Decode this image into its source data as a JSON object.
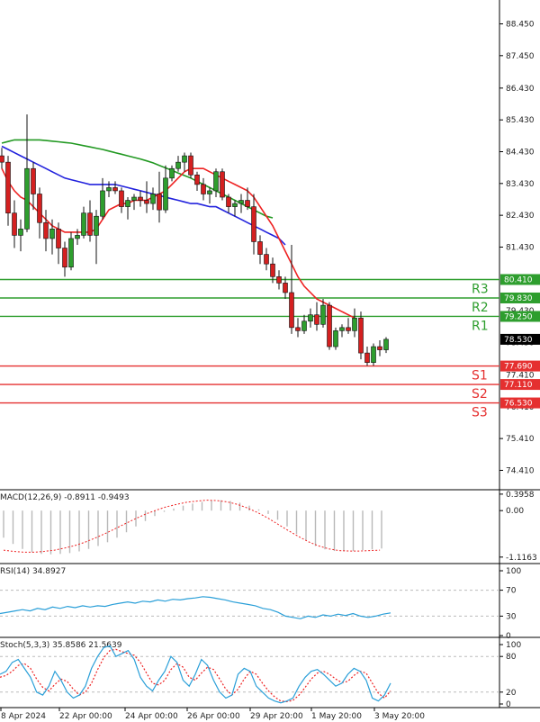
{
  "chart_data": [
    {
      "type": "candlestick",
      "ylim": [
        73.8,
        89.2
      ],
      "yticks": [
        "88.450",
        "87.450",
        "86.430",
        "85.430",
        "84.430",
        "83.430",
        "82.430",
        "81.430",
        "75.410",
        "74.410"
      ],
      "ytick_values": [
        88.45,
        87.45,
        86.43,
        85.43,
        84.43,
        83.43,
        82.43,
        81.43,
        75.41,
        74.41
      ],
      "ohlc": [
        [
          84.3,
          84.55,
          83.9,
          84.1
        ],
        [
          84.1,
          84.3,
          82.1,
          82.5
        ],
        [
          82.5,
          82.9,
          81.4,
          81.8
        ],
        [
          81.8,
          82.3,
          81.3,
          82.0
        ],
        [
          82.0,
          85.6,
          81.9,
          83.9
        ],
        [
          83.9,
          84.1,
          82.6,
          83.1
        ],
        [
          83.1,
          83.3,
          81.7,
          82.2
        ],
        [
          82.2,
          82.6,
          81.3,
          81.7
        ],
        [
          81.7,
          82.3,
          81.2,
          82.0
        ],
        [
          82.0,
          82.2,
          80.9,
          81.4
        ],
        [
          81.4,
          81.6,
          80.5,
          80.8
        ],
        [
          80.8,
          81.9,
          80.7,
          81.7
        ],
        [
          81.7,
          82.0,
          81.5,
          81.8
        ],
        [
          81.8,
          82.7,
          81.7,
          82.5
        ],
        [
          82.5,
          82.9,
          81.6,
          81.8
        ],
        [
          81.8,
          82.6,
          80.9,
          82.4
        ],
        [
          82.4,
          83.6,
          82.3,
          83.2
        ],
        [
          83.2,
          83.5,
          83.0,
          83.3
        ],
        [
          83.3,
          83.5,
          83.1,
          83.2
        ],
        [
          83.2,
          83.3,
          82.5,
          82.7
        ],
        [
          82.7,
          83.0,
          82.3,
          82.9
        ],
        [
          82.9,
          83.1,
          82.6,
          83.0
        ],
        [
          83.0,
          83.2,
          82.7,
          82.9
        ],
        [
          82.9,
          83.5,
          82.5,
          82.8
        ],
        [
          82.8,
          83.3,
          82.6,
          83.1
        ],
        [
          83.1,
          83.8,
          82.2,
          82.6
        ],
        [
          82.6,
          84.0,
          82.5,
          83.6
        ],
        [
          83.6,
          84.0,
          83.5,
          83.9
        ],
        [
          83.9,
          84.3,
          83.8,
          84.1
        ],
        [
          84.1,
          84.4,
          83.8,
          84.3
        ],
        [
          84.3,
          84.4,
          83.6,
          83.7
        ],
        [
          83.7,
          83.8,
          83.2,
          83.4
        ],
        [
          83.4,
          83.6,
          82.9,
          83.1
        ],
        [
          83.1,
          83.3,
          82.8,
          83.2
        ],
        [
          83.2,
          83.9,
          83.0,
          83.8
        ],
        [
          83.8,
          83.9,
          82.9,
          83.0
        ],
        [
          83.0,
          83.1,
          82.5,
          82.7
        ],
        [
          82.7,
          82.9,
          82.4,
          82.8
        ],
        [
          82.8,
          83.1,
          82.5,
          82.9
        ],
        [
          82.9,
          83.3,
          82.6,
          82.7
        ],
        [
          82.7,
          83.1,
          81.2,
          81.6
        ],
        [
          81.6,
          81.8,
          80.9,
          81.2
        ],
        [
          81.2,
          81.4,
          80.7,
          80.9
        ],
        [
          80.9,
          81.1,
          80.3,
          80.5
        ],
        [
          80.5,
          80.7,
          80.1,
          80.3
        ],
        [
          80.3,
          80.5,
          79.8,
          80.0
        ],
        [
          80.0,
          81.5,
          78.7,
          78.9
        ],
        [
          78.9,
          79.2,
          78.6,
          78.8
        ],
        [
          78.8,
          79.3,
          78.7,
          79.1
        ],
        [
          79.1,
          79.5,
          78.9,
          79.3
        ],
        [
          79.3,
          79.7,
          78.8,
          79.0
        ],
        [
          79.0,
          79.8,
          78.9,
          79.6
        ],
        [
          79.6,
          79.7,
          78.2,
          78.3
        ],
        [
          78.3,
          78.9,
          78.2,
          78.8
        ],
        [
          78.8,
          79.0,
          78.6,
          78.9
        ],
        [
          78.9,
          79.2,
          78.7,
          78.8
        ],
        [
          78.8,
          79.5,
          78.6,
          79.2
        ],
        [
          79.2,
          79.4,
          77.9,
          78.1
        ],
        [
          78.1,
          78.3,
          77.7,
          77.8
        ],
        [
          77.8,
          78.4,
          77.7,
          78.3
        ],
        [
          78.3,
          78.5,
          78.0,
          78.2
        ],
        [
          78.2,
          78.6,
          78.1,
          78.53
        ]
      ],
      "ma_fast": [
        83.9,
        83.5,
        83.2,
        83.0,
        82.9,
        82.7,
        82.5,
        82.3,
        82.1,
        82.0,
        81.9,
        81.9,
        81.9,
        81.9,
        81.9,
        82.0,
        82.3,
        82.6,
        82.7,
        82.8,
        82.8,
        82.9,
        82.9,
        82.9,
        83.0,
        83.1,
        83.2,
        83.4,
        83.6,
        83.8,
        83.9,
        83.9,
        83.9,
        83.8,
        83.7,
        83.6,
        83.5,
        83.4,
        83.3,
        83.2,
        83.0,
        82.7,
        82.4,
        82.1,
        81.7,
        81.3,
        80.9,
        80.5,
        80.2,
        80.0,
        79.8,
        79.7,
        79.6,
        79.5,
        79.4,
        79.3,
        79.2
      ],
      "ma_mid": [
        84.6,
        84.5,
        84.4,
        84.3,
        84.2,
        84.1,
        84.0,
        83.9,
        83.8,
        83.7,
        83.6,
        83.55,
        83.5,
        83.45,
        83.4,
        83.4,
        83.4,
        83.4,
        83.4,
        83.35,
        83.3,
        83.25,
        83.2,
        83.15,
        83.1,
        83.05,
        83.0,
        82.95,
        82.9,
        82.85,
        82.8,
        82.8,
        82.75,
        82.7,
        82.7,
        82.6,
        82.5,
        82.4,
        82.3,
        82.2,
        82.1,
        82.0,
        81.9,
        81.8,
        81.7,
        81.5
      ],
      "ma_slow": [
        84.7,
        84.75,
        84.8,
        84.8,
        84.8,
        84.8,
        84.8,
        84.78,
        84.76,
        84.74,
        84.72,
        84.7,
        84.66,
        84.62,
        84.58,
        84.54,
        84.5,
        84.45,
        84.4,
        84.35,
        84.3,
        84.25,
        84.2,
        84.14,
        84.08,
        84.0,
        83.92,
        83.84,
        83.76,
        83.68,
        83.6,
        83.5,
        83.4,
        83.3,
        83.2,
        83.1,
        83.0,
        82.9,
        82.8,
        82.7,
        82.6,
        82.5,
        82.4,
        82.35
      ],
      "levels": [
        {
          "name": "R3",
          "value": 80.41,
          "label": "80.410",
          "color": "#2e9e2e"
        },
        {
          "name": "R2",
          "value": 79.83,
          "label": "79.830",
          "color": "#2e9e2e"
        },
        {
          "name": "R1",
          "value": 79.25,
          "label": "79.250",
          "color": "#2e9e2e"
        },
        {
          "name": "S1",
          "value": 77.69,
          "label": "77.690",
          "color": "#e53030"
        },
        {
          "name": "S2",
          "value": 77.11,
          "label": "77.110",
          "color": "#e53030"
        },
        {
          "name": "S3",
          "value": 76.53,
          "label": "76.530",
          "color": "#e53030"
        }
      ],
      "last_price": {
        "value": 78.53,
        "label": "78.530"
      },
      "partial_ticks": [
        {
          "text": "79.430",
          "value": 79.43
        },
        {
          "text": "77.410",
          "value": 77.41
        },
        {
          "text": "76.410",
          "value": 76.41
        },
        {
          "text": "78.430",
          "value": 78.43
        }
      ],
      "colors": {
        "bull": "#2e9e2e",
        "bear": "#d42020",
        "ma_fast": "#ee2222",
        "ma_mid": "#2222dd",
        "ma_slow": "#229922"
      }
    },
    {
      "type": "bar",
      "name": "MACD",
      "header": "MACD(12,26,9) -0.8911 -0.9493",
      "ylim": [
        -1.25,
        0.48
      ],
      "yticks": [
        "0.3958",
        "0.00",
        "-1.1163"
      ],
      "ytick_values": [
        0.3958,
        0.0,
        -1.1163
      ],
      "histogram": [
        -0.65,
        -0.8,
        -0.92,
        -1.0,
        -1.04,
        -1.05,
        -1.04,
        -1.02,
        -0.98,
        -0.92,
        -0.85,
        -0.76,
        -0.65,
        -0.52,
        -0.38,
        -0.25,
        -0.13,
        -0.03,
        0.05,
        0.12,
        0.17,
        0.21,
        0.24,
        0.25,
        0.23,
        0.19,
        0.12,
        0.03,
        -0.08,
        -0.22,
        -0.38,
        -0.56,
        -0.72,
        -0.85,
        -0.93,
        -0.97,
        -0.98,
        -0.97,
        -0.95,
        -0.93,
        -0.91
      ],
      "signal": [
        -0.95,
        -0.98,
        -1.0,
        -1.0,
        -0.98,
        -0.95,
        -0.9,
        -0.84,
        -0.76,
        -0.66,
        -0.55,
        -0.43,
        -0.31,
        -0.19,
        -0.08,
        0.01,
        0.09,
        0.15,
        0.2,
        0.23,
        0.25,
        0.24,
        0.21,
        0.15,
        0.06,
        -0.05,
        -0.18,
        -0.33,
        -0.48,
        -0.62,
        -0.75,
        -0.85,
        -0.92,
        -0.96,
        -0.97,
        -0.97,
        -0.96,
        -0.95
      ],
      "colors": {
        "bars": "#b8b8b8",
        "signal": "#ee2222"
      }
    },
    {
      "type": "line",
      "name": "RSI",
      "header": "RSI(14) 34.8927",
      "ylim": [
        0,
        100
      ],
      "yticks": [
        "100",
        "70",
        "30",
        "0"
      ],
      "ytick_values": [
        100,
        70,
        30,
        0
      ],
      "values": [
        34,
        36,
        38,
        40,
        38,
        42,
        40,
        44,
        42,
        45,
        43,
        46,
        44,
        46,
        45,
        48,
        50,
        52,
        50,
        53,
        52,
        55,
        53,
        56,
        55,
        57,
        58,
        60,
        59,
        57,
        55,
        52,
        50,
        48,
        46,
        42,
        40,
        36,
        30,
        28,
        26,
        30,
        28,
        32,
        30,
        33,
        31,
        34,
        30,
        28,
        30,
        33,
        35
      ],
      "colors": {
        "line": "#2a9fd8"
      }
    },
    {
      "type": "line",
      "name": "Stochastic",
      "header": "Stoch(5,3,3) 35.8586 21.5639",
      "ylim": [
        0,
        100
      ],
      "yticks": [
        "100",
        "80",
        "20",
        "0"
      ],
      "ytick_values": [
        100,
        80,
        20,
        0
      ],
      "k": [
        50,
        55,
        70,
        75,
        60,
        45,
        20,
        15,
        30,
        55,
        40,
        20,
        10,
        15,
        30,
        60,
        80,
        95,
        98,
        80,
        85,
        90,
        75,
        45,
        30,
        22,
        40,
        55,
        80,
        70,
        40,
        30,
        50,
        75,
        65,
        40,
        20,
        10,
        15,
        50,
        60,
        55,
        30,
        20,
        10,
        5,
        2,
        5,
        10,
        30,
        45,
        55,
        58,
        50,
        40,
        30,
        35,
        50,
        60,
        55,
        40,
        10,
        5,
        15,
        35
      ],
      "d": [
        45,
        48,
        55,
        65,
        68,
        60,
        42,
        28,
        22,
        33,
        42,
        38,
        25,
        15,
        20,
        35,
        58,
        78,
        90,
        92,
        88,
        85,
        82,
        70,
        52,
        35,
        32,
        40,
        58,
        68,
        62,
        45,
        40,
        52,
        62,
        58,
        42,
        25,
        15,
        25,
        42,
        55,
        50,
        35,
        22,
        12,
        5,
        4,
        6,
        15,
        28,
        42,
        52,
        55,
        50,
        42,
        36,
        38,
        48,
        55,
        52,
        35,
        18,
        10,
        22
      ],
      "colors": {
        "k": "#2a9fd8",
        "d": "#ee2222"
      }
    }
  ],
  "x_labels": [
    "8 Apr 2024",
    "22 Apr 00:00",
    "24 Apr 00:00",
    "26 Apr 00:00",
    "29 Apr 20:00",
    "1 May 20:00",
    "3 May 20:00"
  ]
}
